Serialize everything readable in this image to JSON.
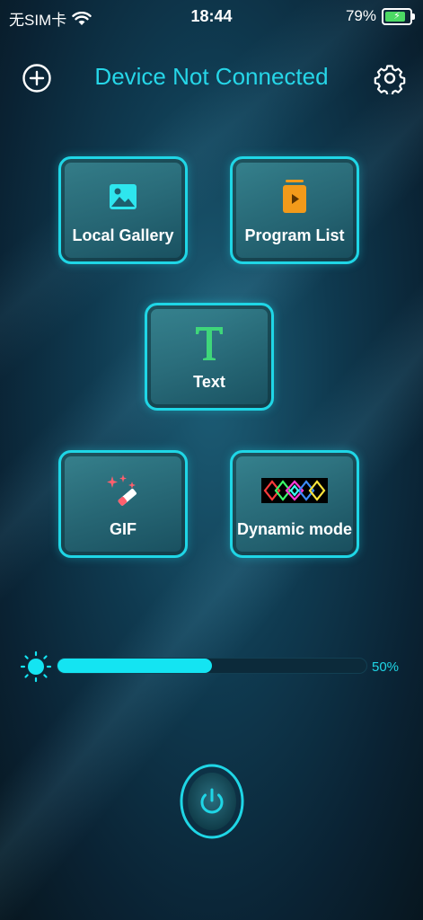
{
  "status_bar": {
    "carrier": "无SIM卡",
    "time": "18:44",
    "battery_percent": "79%",
    "battery_level": 0.79,
    "charging": true
  },
  "header": {
    "title": "Device Not Connected",
    "add_icon": "plus-circle-icon",
    "settings_icon": "gear-icon"
  },
  "tiles": [
    {
      "label": "Local Gallery",
      "icon": "image-icon"
    },
    {
      "label": "Program List",
      "icon": "playlist-icon"
    },
    {
      "label": "Text",
      "icon": "text-icon"
    },
    {
      "label": "GIF",
      "icon": "magic-wand-icon"
    },
    {
      "label": "Dynamic mode",
      "icon": "dynamic-pattern-icon"
    }
  ],
  "brightness": {
    "value_label": "50%",
    "value": 0.5,
    "icon": "sun-icon"
  },
  "power": {
    "icon": "power-icon"
  },
  "colors": {
    "accent": "#1fd6e6",
    "title": "#26d6e8",
    "background": "#0f3a50"
  }
}
